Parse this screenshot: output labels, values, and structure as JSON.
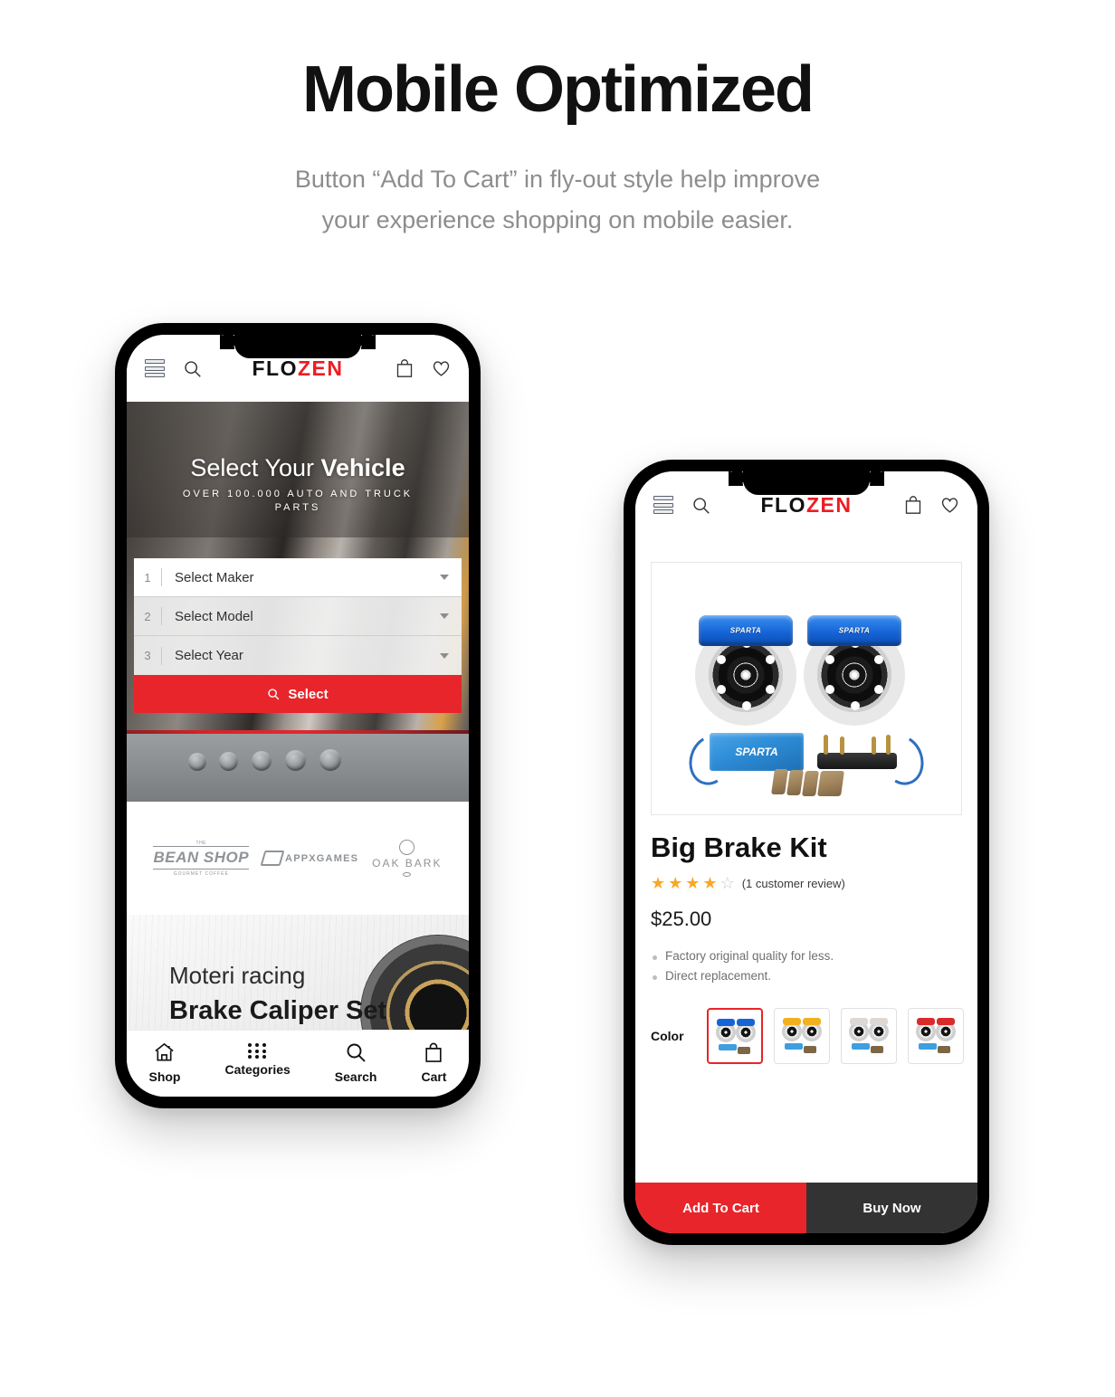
{
  "header": {
    "title": "Mobile Optimized",
    "subtitle_line1": "Button “Add To Cart” in fly-out style help improve",
    "subtitle_line2": "your experience shopping on mobile easier."
  },
  "brand": {
    "name_part1": "FLO",
    "name_part2": "ZEN",
    "accent_color": "#ED1C24"
  },
  "phone1": {
    "appbar": {
      "menu_icon": "hamburger-icon",
      "search_icon": "search-icon",
      "cart_icon": "shopping-bag-icon",
      "wishlist_icon": "heart-icon"
    },
    "hero": {
      "title_light": "Select Your ",
      "title_bold": "Vehicle",
      "subtitle": "OVER 100.000 AUTO AND TRUCK PARTS"
    },
    "vehicle_selector": {
      "rows": [
        {
          "number": "1",
          "label": "Select Maker"
        },
        {
          "number": "2",
          "label": "Select Model"
        },
        {
          "number": "3",
          "label": "Select Year"
        }
      ],
      "button_label": "Select",
      "button_icon": "search-icon",
      "button_color": "#E8252A"
    },
    "brands": [
      {
        "top": "THE",
        "main": "BEAN SHOP",
        "sub": "GOURMET COFFEE"
      },
      {
        "main": "APPXGAMES"
      },
      {
        "main": "OAK BARK"
      }
    ],
    "promo": {
      "line1": "Moteri racing",
      "line2": "Brake Caliper Set"
    },
    "bottom_nav": [
      {
        "icon": "home-icon",
        "label": "Shop"
      },
      {
        "icon": "grid-dots-icon",
        "label": "Categories"
      },
      {
        "icon": "search-icon",
        "label": "Search"
      },
      {
        "icon": "shopping-bag-icon",
        "label": "Cart"
      }
    ]
  },
  "phone2": {
    "appbar": {
      "menu_icon": "hamburger-icon",
      "search_icon": "search-icon",
      "cart_icon": "shopping-bag-icon",
      "wishlist_icon": "heart-icon"
    },
    "product": {
      "image_alt": "sparta-big-brake-kit-blue",
      "image_brand": "SPARTA",
      "title": "Big Brake Kit",
      "rating_filled": 4,
      "rating_total": 5,
      "review_text": "(1 customer review)",
      "price": "$25.00",
      "bullets": [
        "Factory original quality for less.",
        "Direct replacement."
      ],
      "color_label": "Color",
      "colors": [
        {
          "name": "Blue",
          "hex": "#1565d8",
          "selected": true
        },
        {
          "name": "Yellow",
          "hex": "#f2b01e",
          "selected": false
        },
        {
          "name": "Silver",
          "hex": "#d8d8d8",
          "selected": false
        },
        {
          "name": "Red",
          "hex": "#d92b2b",
          "selected": false
        }
      ]
    },
    "cta": {
      "add_to_cart": "Add To Cart",
      "buy_now": "Buy Now",
      "add_color": "#E8252A",
      "buy_color": "#333333"
    }
  }
}
